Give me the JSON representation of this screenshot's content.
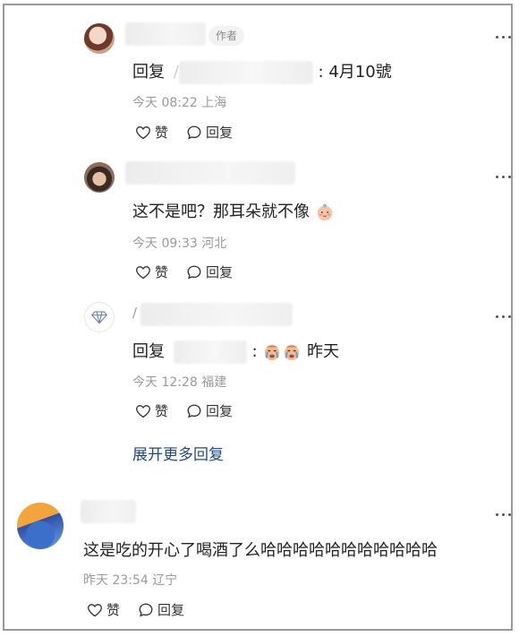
{
  "replies": [
    {
      "author_badge": "作者",
      "reply_prefix": "回复",
      "reply_colon_text": ": 4月10號",
      "time": "今天 08:22",
      "location": "上海",
      "like_label": "赞",
      "reply_label": "回复",
      "avatar_icon": "user-avatar-girl"
    },
    {
      "text": "这不是吧？那耳朵就不像",
      "emoji_icon": "baby-face-emoji",
      "time": "今天 09:33",
      "location": "河北",
      "like_label": "赞",
      "reply_label": "回复",
      "avatar_icon": "user-avatar-photo"
    },
    {
      "name_initial": "/",
      "reply_prefix": "回复",
      "reply_colon": ":",
      "reply_tail": "昨天",
      "emoji_icon": "crying-face-emoji",
      "time": "今天 12:28",
      "location": "福建",
      "like_label": "赞",
      "reply_label": "回复",
      "avatar_icon": "diamond-avatar-icon"
    }
  ],
  "expand_more": "展开更多回复",
  "comment": {
    "text": "这是吃的开心了喝酒了么哈哈哈哈哈哈哈哈哈哈哈",
    "time": "昨天 23:54",
    "location": "辽宁",
    "like_label": "赞",
    "reply_label": "回复",
    "avatar_icon": "anime-avatar"
  }
}
